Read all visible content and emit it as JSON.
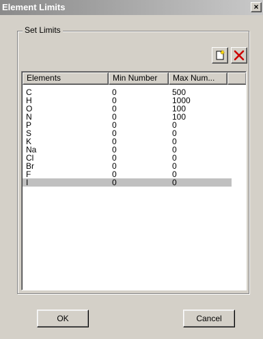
{
  "window": {
    "title": "Element Limits",
    "close_label": "×"
  },
  "group": {
    "label": "Set Limits"
  },
  "toolbar": {
    "new_icon": "new-item-icon",
    "delete_icon": "delete-x-icon",
    "delete_color": "#cc0000"
  },
  "list": {
    "columns": [
      "Elements",
      "Min Number",
      "Max Num...",
      ""
    ],
    "rows": [
      {
        "element": "C",
        "min": "0",
        "max": "500"
      },
      {
        "element": "H",
        "min": "0",
        "max": "1000"
      },
      {
        "element": "O",
        "min": "0",
        "max": "100"
      },
      {
        "element": "N",
        "min": "0",
        "max": "100"
      },
      {
        "element": "P",
        "min": "0",
        "max": "0"
      },
      {
        "element": "S",
        "min": "0",
        "max": "0"
      },
      {
        "element": "K",
        "min": "0",
        "max": "0"
      },
      {
        "element": "Na",
        "min": "0",
        "max": "0"
      },
      {
        "element": "Cl",
        "min": "0",
        "max": "0"
      },
      {
        "element": "Br",
        "min": "0",
        "max": "0"
      },
      {
        "element": "F",
        "min": "0",
        "max": "0"
      },
      {
        "element": "I",
        "min": "0",
        "max": "0",
        "selected": true
      }
    ]
  },
  "buttons": {
    "ok_label": "OK",
    "cancel_label": "Cancel"
  }
}
